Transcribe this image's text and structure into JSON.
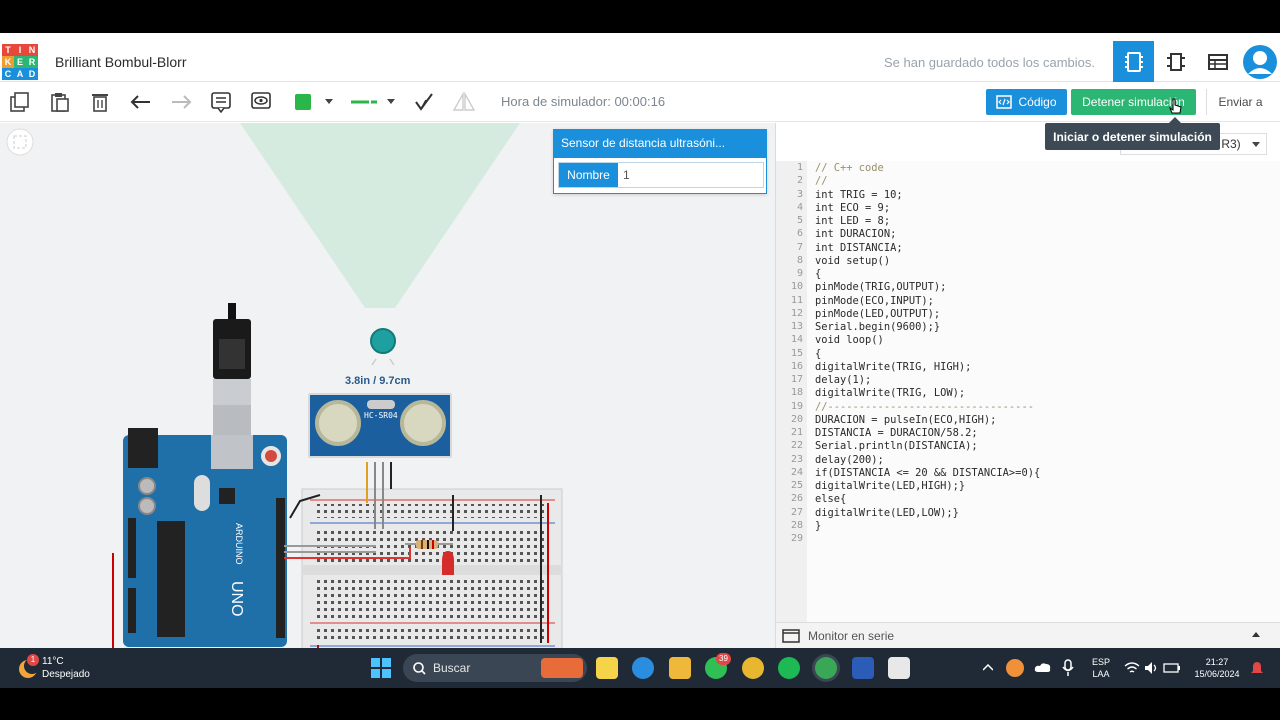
{
  "app": {
    "logo_letters": [
      "T",
      "I",
      "N",
      "K",
      "E",
      "R",
      "C",
      "A",
      "D"
    ],
    "project_name": "Brilliant Bombul-Blorr",
    "saved_status": "Se han guardado todos los cambios."
  },
  "toolbar": {
    "sim_timer": "Hora de simulador: 00:00:16",
    "code_button": "Código",
    "stop_sim_button": "Detener simulación",
    "send_button": "Enviar a",
    "color_swatch": "#2bb64a"
  },
  "tooltip": {
    "text": "Iniciar o detener simulación"
  },
  "inspector": {
    "title": "Sensor de distancia ultrasóni...",
    "name_label": "Nombre",
    "name_value": "1"
  },
  "canvas": {
    "distance_readout": "3.8in / 9.7cm",
    "sensor_label": "HC-SR04"
  },
  "code": {
    "board_select": "R3)",
    "lines": [
      "// C++ code",
      "//",
      "int TRIG = 10;",
      "int ECO = 9;",
      "int LED = 8;",
      "int DURACION;",
      "int DISTANCIA;",
      "void setup()",
      "{",
      "pinMode(TRIG,OUTPUT);",
      "pinMode(ECO,INPUT);",
      "pinMode(LED,OUTPUT);",
      "Serial.begin(9600);}",
      "void loop()",
      "{",
      "digitalWrite(TRIG, HIGH);",
      "delay(1);",
      "digitalWrite(TRIG, LOW);",
      "//---------------------------------",
      "DURACION = pulseIn(ECO,HIGH);",
      "DISTANCIA = DURACION/58.2;",
      "Serial.println(DISTANCIA);",
      "delay(200);",
      "if(DISTANCIA <= 20 && DISTANCIA>=0){",
      "digitalWrite(LED,HIGH);}",
      "else{",
      "digitalWrite(LED,LOW);}",
      "}",
      ""
    ],
    "serial_monitor": "Monitor en serie"
  },
  "taskbar": {
    "temperature": "11°C",
    "weather": "Despejado",
    "weather_badge": "1",
    "search": "Buscar",
    "whatsapp_badge": "39",
    "language": "ESP",
    "layout": "LAA",
    "time": "21:27",
    "date": "15/06/2024"
  }
}
